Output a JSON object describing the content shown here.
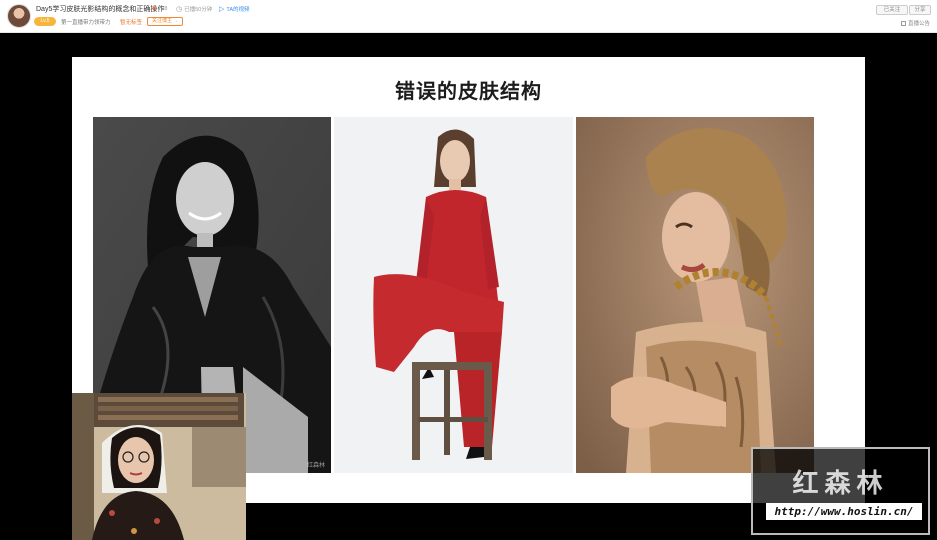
{
  "header": {
    "title": "Day5学习皮肤光影结构的概念和正确操作",
    "hot_count": "778",
    "time": "已播50分钟",
    "ta_link": "TA的视频",
    "level_badge": "Lv.5",
    "subtitle": "第一直播带力领带力",
    "tag": "暂无标签",
    "follow_button": "关注博主 →",
    "followed_button": "已关注",
    "share_button": "分享",
    "report_label": "直播公告"
  },
  "slide": {
    "title": "错误的皮肤结构",
    "photo1_watermark": "红森林"
  },
  "logo": {
    "text": "红森林",
    "url": "http://www.hoslin.cn/"
  },
  "colors": {
    "accent_orange": "#f08a33",
    "link_blue": "#3a8ee6",
    "badge_yellow": "#f6b63a",
    "suit_red": "#c0262b"
  }
}
